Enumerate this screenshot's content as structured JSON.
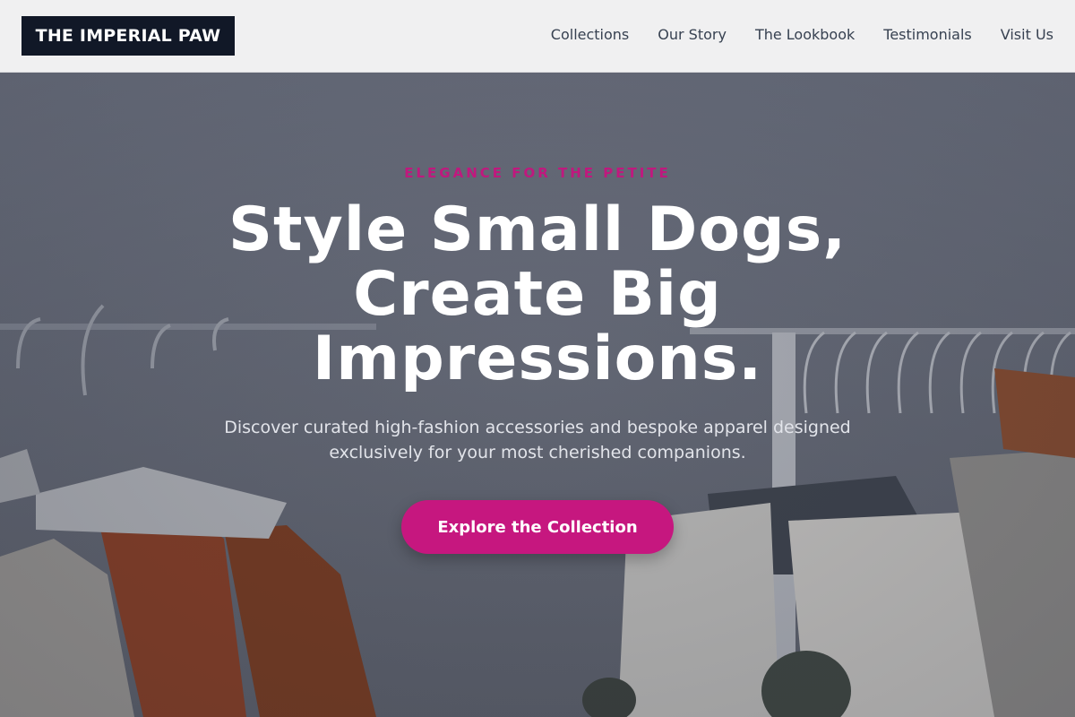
{
  "brand": {
    "logo_text": "THE IMPERIAL PAW"
  },
  "nav": {
    "items": [
      {
        "label": "Collections"
      },
      {
        "label": "Our Story"
      },
      {
        "label": "The Lookbook"
      },
      {
        "label": "Testimonials"
      },
      {
        "label": "Visit Us"
      }
    ]
  },
  "hero": {
    "eyebrow": "ELEGANCE FOR THE PETITE",
    "title_lines": [
      "Style Small Dogs,",
      "Create Big",
      "Impressions."
    ],
    "subtitle": "Discover curated high-fashion accessories and bespoke apparel designed exclusively for your most cherished companions.",
    "cta_label": "Explore the Collection",
    "background_image": "clothing-rack-photo"
  },
  "colors": {
    "accent": "#c6177f",
    "logo_bg": "#111827",
    "header_bg": "#f0f0f1",
    "nav_text": "#374151"
  }
}
